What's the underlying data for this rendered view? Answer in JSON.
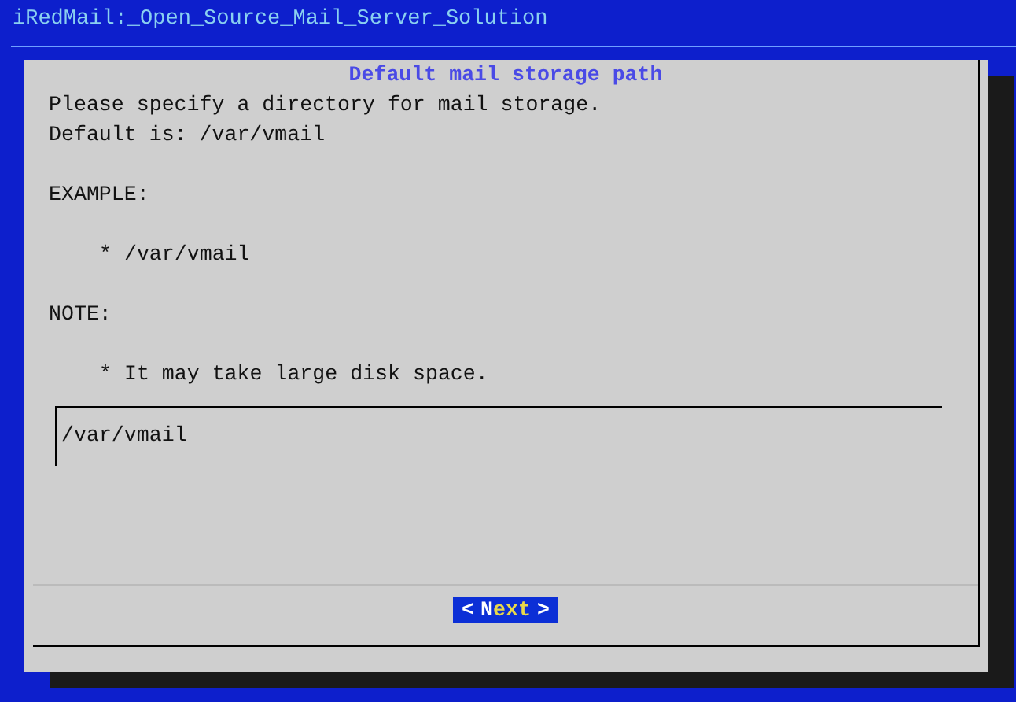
{
  "screen_title": "iRedMail:_Open_Source_Mail_Server_Solution",
  "dialog": {
    "title": "Default mail storage path",
    "message": [
      {
        "lines": [
          "Please specify a directory for mail storage.",
          "Default is: /var/vmail"
        ],
        "indented": false
      },
      {
        "lines": [
          "EXAMPLE:"
        ],
        "indented": false
      },
      {
        "lines": [
          "* /var/vmail"
        ],
        "indented": true
      },
      {
        "lines": [
          "NOTE:"
        ],
        "indented": false
      },
      {
        "lines": [
          "* It may take large disk space."
        ],
        "indented": true
      }
    ],
    "input": {
      "value": "/var/vmail"
    },
    "buttons": [
      {
        "open": "<",
        "hotkey": "N",
        "rest": "ext",
        "close": ">",
        "selected": true
      }
    ]
  }
}
